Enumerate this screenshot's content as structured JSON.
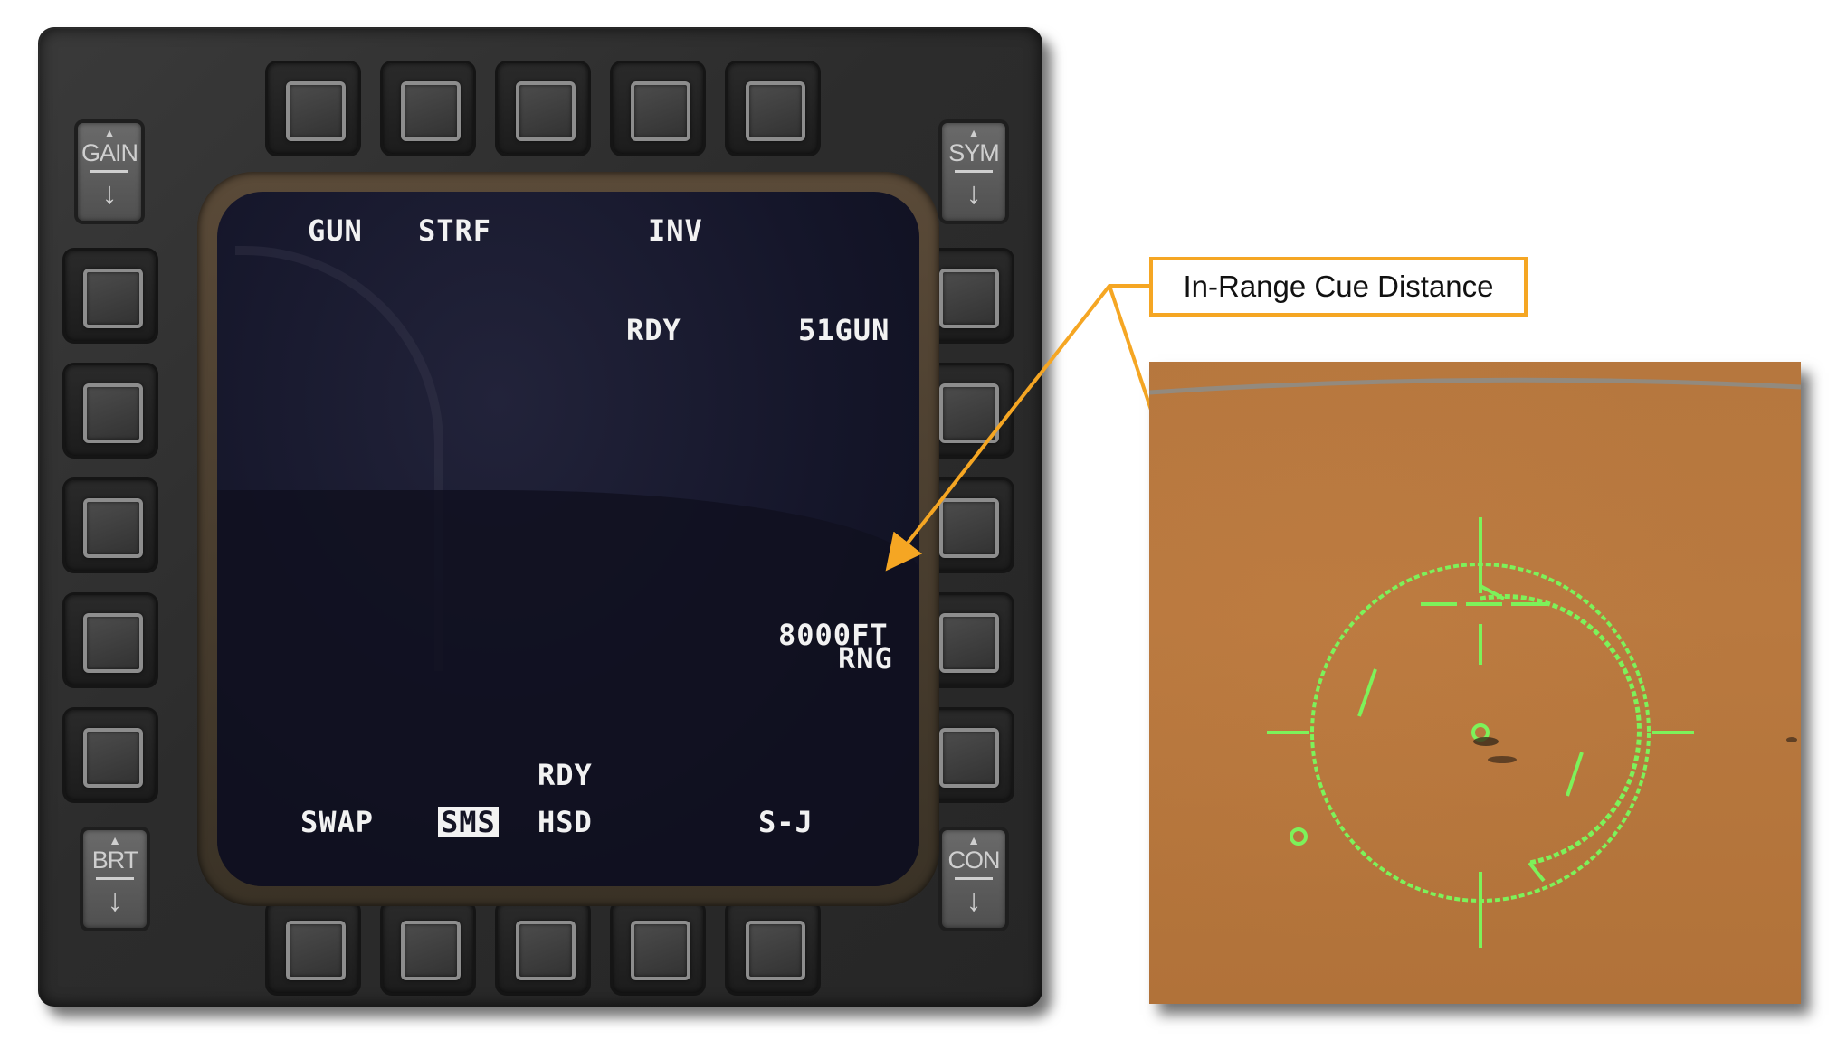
{
  "mfd": {
    "rockers": {
      "top_left": "GAIN",
      "top_right": "SYM",
      "bottom_left": "BRT",
      "bottom_right": "CON"
    },
    "display": {
      "top_labels": {
        "gun": "GUN",
        "strf": "STRF",
        "inv": "INV"
      },
      "status": {
        "rdy": "RDY",
        "rounds": "51GUN"
      },
      "range": {
        "value": "8000FT",
        "label": "RNG"
      },
      "bottom_rdy": "RDY",
      "bottom_labels": {
        "swap": "SWAP",
        "sms": "SMS",
        "hsd": "HSD",
        "sj": "S-J"
      }
    }
  },
  "callout": {
    "text": "In-Range Cue Distance"
  },
  "colors": {
    "callout_orange": "#f5a623",
    "hud_green": "#7df25a",
    "mfd_text": "#f2f2f2"
  }
}
